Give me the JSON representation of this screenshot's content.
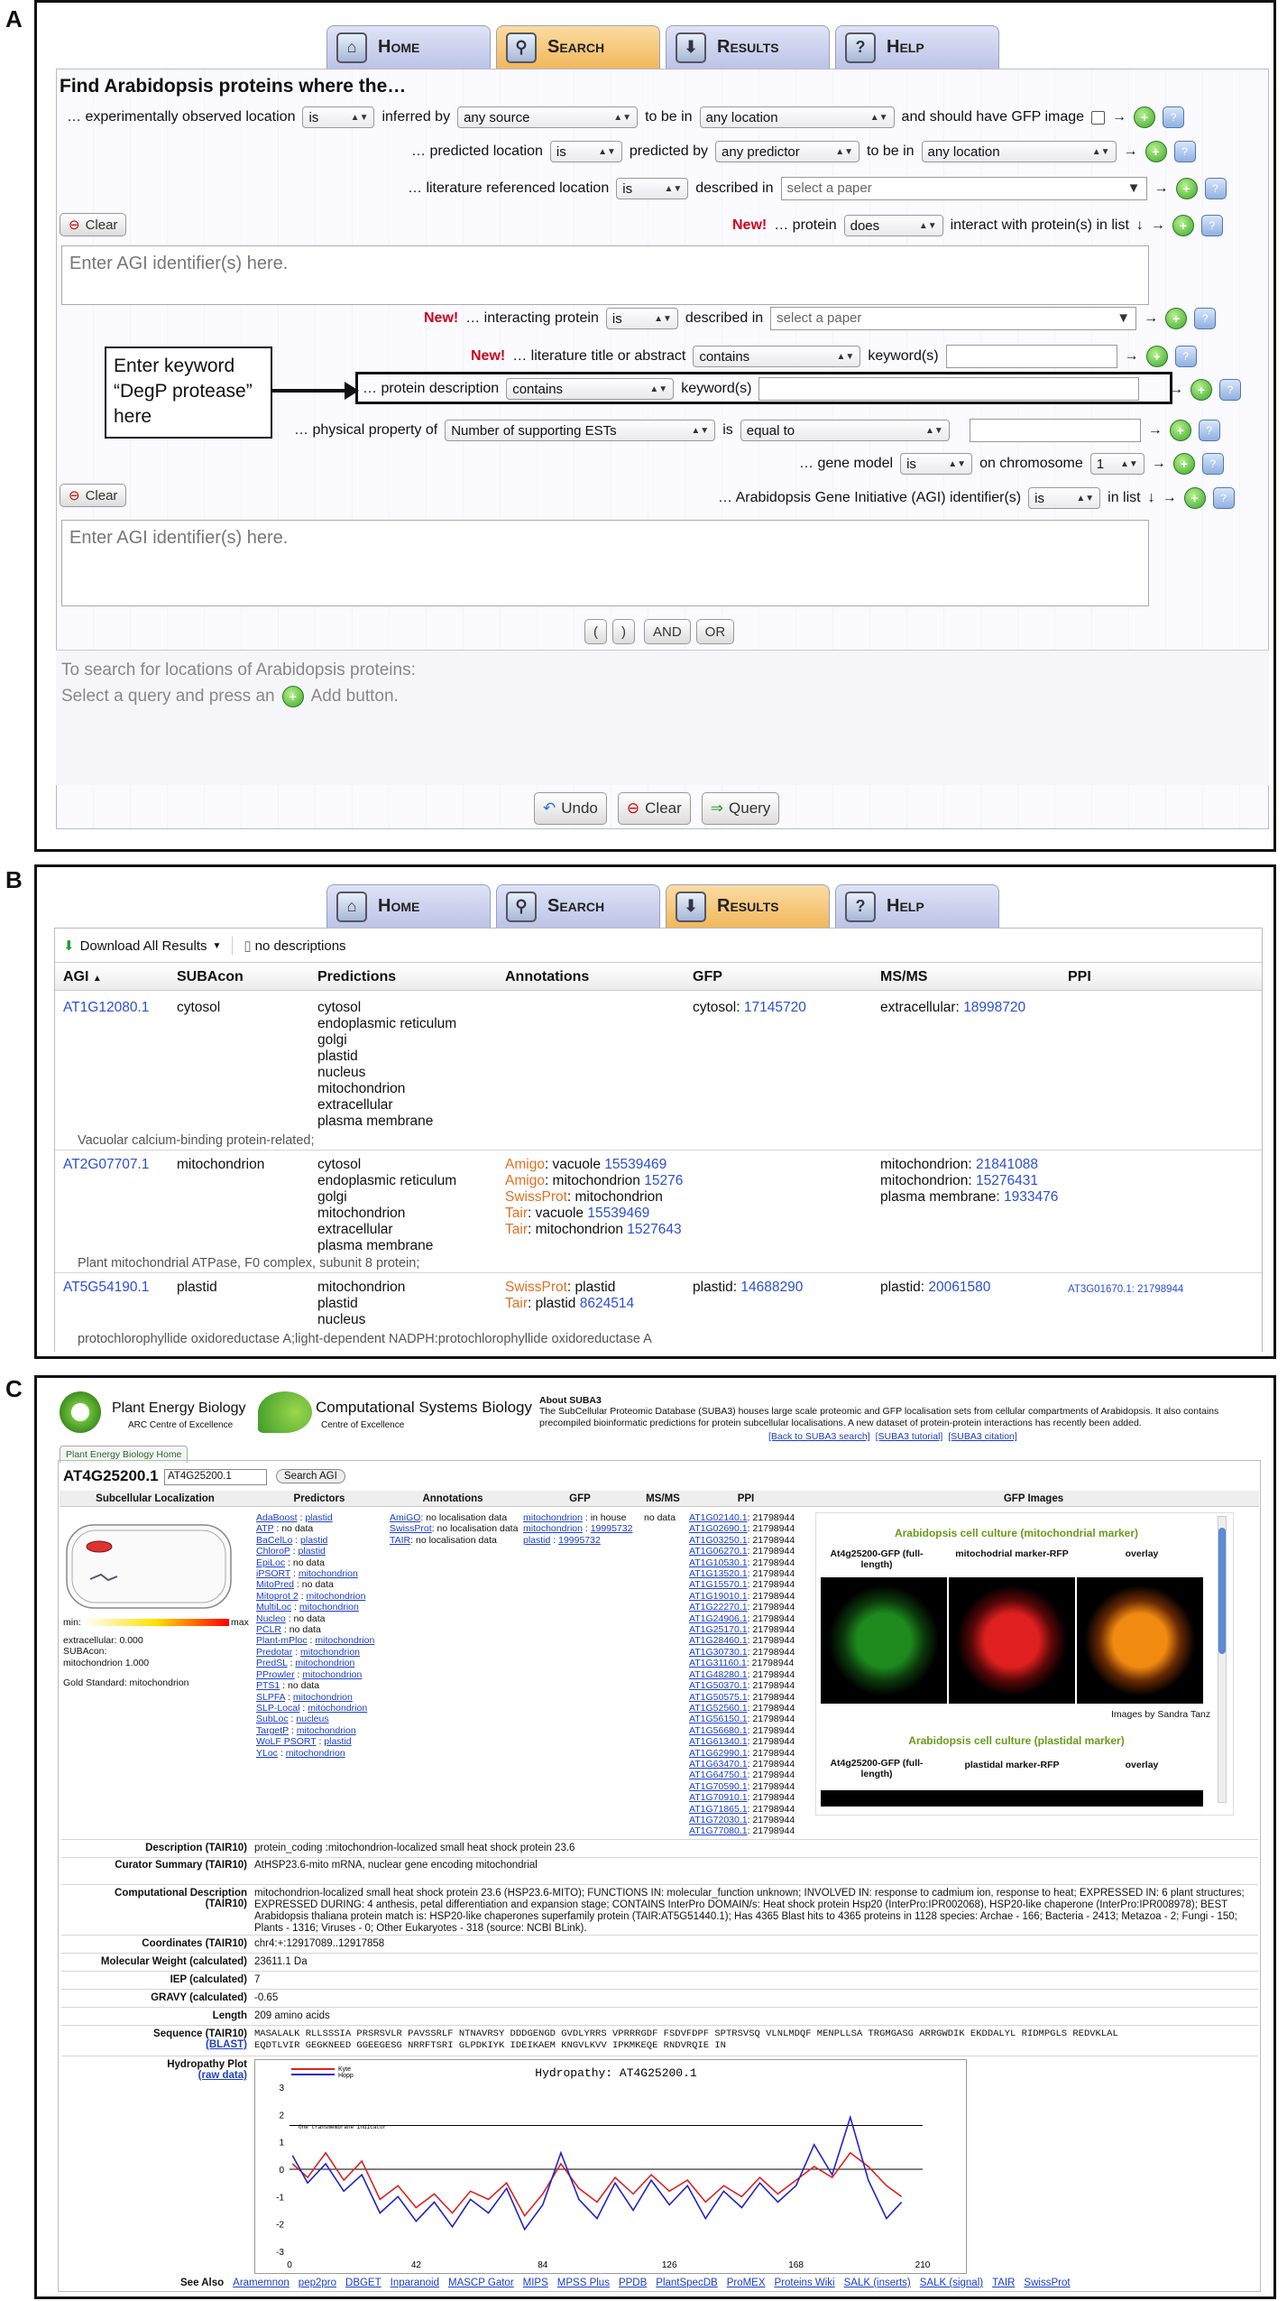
{
  "labels": {
    "a": "A",
    "b": "B",
    "c": "C"
  },
  "tabs": [
    {
      "label": "Home",
      "icon": "home-icon"
    },
    {
      "label": "Search",
      "icon": "search-icon"
    },
    {
      "label": "Results",
      "icon": "download-icon"
    },
    {
      "label": "Help",
      "icon": "help-icon"
    }
  ],
  "query": {
    "title": "Find Arabidopsis proteins where the…",
    "r1": {
      "a": "… experimentally observed location",
      "op": "is",
      "b": "inferred by",
      "src": "any source",
      "c": "to be in",
      "loc": "any location",
      "d": "and should have GFP image"
    },
    "r2": {
      "a": "… predicted location",
      "op": "is",
      "b": "predicted by",
      "src": "any predictor",
      "c": "to be in",
      "loc": "any location"
    },
    "r3": {
      "a": "… literature referenced location",
      "op": "is",
      "b": "described in",
      "ph": "select a paper"
    },
    "clear": "Clear",
    "new": "New!",
    "r4": {
      "a": "… protein",
      "op": "does",
      "b": "interact with protein(s) in list",
      "arrow": "↓"
    },
    "agi_ph": "Enter AGI identifier(s) here.",
    "r5": {
      "a": "… interacting protein",
      "op": "is",
      "b": "described in",
      "ph": "select a paper"
    },
    "r6": {
      "a": "… literature title or abstract",
      "op": "contains",
      "b": "keyword(s)"
    },
    "r7": {
      "a": "… protein description",
      "op": "contains",
      "b": "keyword(s)"
    },
    "r8": {
      "a": "… physical property of",
      "prop": "Number of supporting ESTs",
      "b": "is",
      "op": "equal to"
    },
    "r9": {
      "a": "… gene model",
      "op": "is",
      "b": "on chromosome",
      "chr": "1"
    },
    "r10": {
      "a": "… Arabidopsis Gene Initiative (AGI) identifier(s)",
      "op": "is",
      "b": "in list",
      "arrow": "↓"
    },
    "callout": [
      "Enter keyword",
      "“DegP protease”",
      "here"
    ],
    "ops": [
      "(",
      ")",
      "AND",
      "OR"
    ],
    "hint1": "To search for locations of Arabidopsis proteins:",
    "hint2a": "Select a query and press an",
    "hint2b": "Add button.",
    "undo": "Undo",
    "clear2": "Clear",
    "query": "Query",
    "arrow": "→"
  },
  "results": {
    "download": "Download All Results",
    "no_desc": "no descriptions",
    "headers": [
      "AGI",
      "SUBAcon",
      "Predictions",
      "Annotations",
      "GFP",
      "MS/MS",
      "PPI"
    ],
    "r1": {
      "agi": "AT1G12080.1",
      "suba": "cytosol",
      "preds": [
        "cytosol",
        "endoplasmic reticulum",
        "golgi",
        "plastid",
        "nucleus",
        "mitochondrion",
        "extracellular",
        "plasma membrane"
      ],
      "gfp_l": "cytosol: ",
      "gfp_v": "17145720",
      "ms_l": "extracellular: ",
      "ms_v": "18998720",
      "desc": "Vacuolar calcium-binding protein-related;"
    },
    "r2": {
      "agi": "AT2G07707.1",
      "suba": "mitochondrion",
      "preds": [
        "cytosol",
        "endoplasmic reticulum",
        "golgi",
        "mitochondrion",
        "extracellular",
        "plasma membrane"
      ],
      "ann": [
        {
          "s": "Amigo",
          "t": ": vacuole ",
          "v": "15539469"
        },
        {
          "s": "Amigo",
          "t": ": mitochondrion ",
          "v": "15276"
        },
        {
          "s": "SwissProt",
          "t": ": mitochondrion",
          "v": ""
        },
        {
          "s": "Tair",
          "t": ": vacuole ",
          "v": "15539469"
        },
        {
          "s": "Tair",
          "t": ": mitochondrion ",
          "v": "1527643"
        }
      ],
      "ms": [
        {
          "t": "mitochondrion: ",
          "v": "21841088"
        },
        {
          "t": "mitochondrion: ",
          "v": "15276431"
        },
        {
          "t": "plasma membrane: ",
          "v": "1933476"
        }
      ],
      "desc": "Plant mitochondrial ATPase, F0 complex, subunit 8 protein;"
    },
    "r3": {
      "agi": "AT5G54190.1",
      "suba": "plastid",
      "preds": [
        "mitochondrion",
        "plastid",
        "nucleus"
      ],
      "ann": [
        {
          "s": "SwissProt",
          "t": ": plastid",
          "v": ""
        },
        {
          "s": "Tair",
          "t": ": plastid ",
          "v": "8624514"
        }
      ],
      "gfp_l": "plastid: ",
      "gfp_v": "14688290",
      "ms_l": "plastid: ",
      "ms_v": "20061580",
      "ppi": "AT3G01670.1: 21798944",
      "desc": "protochlorophyllide oxidoreductase A;light-dependent NADPH:protochlorophyllide oxidoreductase A"
    }
  },
  "suba": {
    "logo1": "Plant Energy Biology",
    "logo1b": "ARC Centre of Excellence",
    "logo2": "Computational Systems Biology",
    "logo2b": "Centre of Excellence",
    "about_t": "About SUBA3",
    "about": "The SubCellular Proteomic Database (SUBA3) houses large scale proteomic and GFP localisation sets from cellular compartments of Arabidopsis. It also contains precompiled bioinformatic predictions for protein subcellular localisations. A new dataset of protein-protein interactions has recently been added.",
    "links": [
      "[Back to SUBA3 search]",
      "[SUBA3 tutorial]",
      "[SUBA3 citation]"
    ],
    "home_tab": "Plant Energy Biology Home",
    "agi": "AT4G25200.1",
    "agi_input": "AT4G25200.1",
    "search": "Search AGI",
    "cols": [
      "Subcellular Localization",
      "Predictors",
      "Annotations",
      "GFP",
      "MS/MS",
      "PPI",
      "GFP Images"
    ],
    "min": "min:",
    "max": "max",
    "loc_info": [
      "extracellular: 0.000",
      "SUBAcon:",
      "mitochondrion 1.000",
      "",
      "Gold Standard: mitochondrion"
    ],
    "predictors": [
      [
        "AdaBoost",
        "plastid"
      ],
      [
        "ATP",
        "no data"
      ],
      [
        "BaCelLo",
        "plastid"
      ],
      [
        "ChloroP",
        "plastid"
      ],
      [
        "EpiLoc",
        "no data"
      ],
      [
        "iPSORT",
        "mitochondrion"
      ],
      [
        "MitoPred",
        "no data"
      ],
      [
        "Mitoprot 2",
        "mitochondrion"
      ],
      [
        "MultiLoc",
        "mitochondrion"
      ],
      [
        "Nucleo",
        "no data"
      ],
      [
        "PCLR",
        "no data"
      ],
      [
        "Plant-mPloc",
        "mitochondrion"
      ],
      [
        "Predotar",
        "mitochondrion"
      ],
      [
        "PredSL",
        "mitochondrion"
      ],
      [
        "PProwler",
        "mitochondrion"
      ],
      [
        "PTS1",
        "no data"
      ],
      [
        "SLPFA",
        "mitochondrion"
      ],
      [
        "SLP-Local",
        "mitochondrion"
      ],
      [
        "SubLoc",
        "nucleus"
      ],
      [
        "TargetP",
        "mitochondrion"
      ],
      [
        "WoLF PSORT",
        "plastid"
      ],
      [
        "YLoc",
        "mitochondrion"
      ]
    ],
    "ann": [
      [
        "AmiGO",
        "no localisation data"
      ],
      [
        "SwissProt",
        "no localisation data"
      ],
      [
        "TAIR",
        "no localisation data"
      ]
    ],
    "gfp": [
      [
        "mitochondrion",
        "in house"
      ],
      [
        "mitochondrion",
        "19995732"
      ],
      [
        "plastid",
        "19995732"
      ]
    ],
    "msms": "no data",
    "ppi": [
      "AT1G02140.1",
      "AT1G02690.1",
      "AT1G03250.1",
      "AT1G06270.1",
      "AT1G10530.1",
      "AT1G13520.1",
      "AT1G15570.1",
      "AT1G19010.1",
      "AT1G22270.1",
      "AT1G24906.1",
      "AT1G25170.1",
      "AT1G28460.1",
      "AT1G30730.1",
      "AT1G31160.1",
      "AT1G48280.1",
      "AT1G50370.1",
      "AT1G50575.1",
      "AT1G52560.1",
      "AT1G56150.1",
      "AT1G56680.1",
      "AT1G61340.1",
      "AT1G62990.1",
      "AT1G63470.1",
      "AT1G64750.1",
      "AT1G70590.1",
      "AT1G70910.1",
      "AT1G71865.1",
      "AT1G72030.1",
      "AT1G77080.1"
    ],
    "ppi_v": ": 21798944",
    "img1_t": "Arabidopsis cell culture (mitochondrial marker)",
    "img_cols": [
      "At4g25200-GFP (full-length)",
      "mitochodrial marker-RFP",
      "overlay"
    ],
    "credit": "Images by Sandra Tanz",
    "img2_t": "Arabidopsis cell culture (plastidal marker)",
    "img2_cols": [
      "At4g25200-GFP (full-length)",
      "plastidal marker-RFP",
      "overlay"
    ],
    "info": [
      {
        "l": "Description (TAIR10)",
        "v": "protein_coding :mitochondrion-localized small heat shock protein 23.6"
      },
      {
        "l": "Curator Summary (TAIR10)",
        "v": "AtHSP23.6-mito mRNA, nuclear gene encoding mitochondrial"
      },
      {
        "l": "Computational Description (TAIR10)",
        "v": "mitochondrion-localized small heat shock protein 23.6 (HSP23.6-MITO); FUNCTIONS IN: molecular_function unknown; INVOLVED IN: response to cadmium ion, response to heat; EXPRESSED IN: 6 plant structures; EXPRESSED DURING: 4 anthesis, petal differentiation and expansion stage; CONTAINS InterPro DOMAIN/s: Heat shock protein Hsp20 (InterPro:IPR002068), HSP20-like chaperone (InterPro:IPR008978); BEST Arabidopsis thaliana protein match is: HSP20-like chaperones superfamily protein (TAIR:AT5G51440.1); Has 4365 Blast hits to 4365 proteins in 1128 species: Archae - 166; Bacteria - 2413; Metazoa - 2; Fungi - 150; Plants - 1316; Viruses - 0; Other Eukaryotes - 318 (source: NCBI BLink)."
      },
      {
        "l": "Coordinates (TAIR10)",
        "v": "chr4:+:12917089..12917858"
      },
      {
        "l": "Molecular Weight (calculated)",
        "v": "23611.1 Da"
      },
      {
        "l": "IEP (calculated)",
        "v": "7"
      },
      {
        "l": "GRAVY (calculated)",
        "v": "-0.65"
      },
      {
        "l": "Length",
        "v": "209 amino acids"
      }
    ],
    "seq_l": "Sequence (TAIR10)",
    "seq_blast": "(BLAST)",
    "seq1": "MASALALK RLLSSSIA PRSRSVLR PAVSSRLF NTNAVRSY DDDGENGD GVDLYRRS VPRRRGDF FSDVFDPF SPTRSVSQ VLNLMDQF MENPLLSA TRGMGASG ARRGWDIK EKDDALYL RIDMPGLS REDVKLAL",
    "seq2": "EQDTLVIR GEGKNEED GGEEGESG NRRFTSRI GLPDKIYK IDEIKAEM KNGVLKVV IPKMKEQE RNDVRQIE IN",
    "hyd_l": "Hydropathy Plot",
    "hyd_raw": "(raw data)",
    "hyd_title": "Hydropathy: AT4G25200.1",
    "tm_ind": "One transmembrane indicator",
    "legend": [
      "Kyte",
      "Hopp"
    ],
    "chart_data": {
      "type": "line",
      "title": "Hydropathy: AT4G25200.1",
      "xlabel": "",
      "ylabel": "",
      "xlim": [
        0,
        210
      ],
      "ylim": [
        -3,
        3
      ],
      "xticks": [
        0,
        42,
        84,
        126,
        168,
        210
      ],
      "yticks": [
        -3,
        -2,
        -1,
        0,
        1,
        2,
        3
      ],
      "threshold": 1.6,
      "series": [
        {
          "name": "Kyte",
          "values": [
            [
              1,
              0.2
            ],
            [
              6,
              -0.3
            ],
            [
              12,
              0.6
            ],
            [
              18,
              -0.4
            ],
            [
              24,
              0.3
            ],
            [
              30,
              -1.1
            ],
            [
              36,
              -0.6
            ],
            [
              42,
              -1.4
            ],
            [
              48,
              -0.9
            ],
            [
              54,
              -1.6
            ],
            [
              60,
              -0.8
            ],
            [
              66,
              -1.1
            ],
            [
              72,
              -0.5
            ],
            [
              78,
              -1.7
            ],
            [
              84,
              -0.9
            ],
            [
              90,
              0.2
            ],
            [
              96,
              -0.7
            ],
            [
              102,
              -1.2
            ],
            [
              108,
              -0.3
            ],
            [
              114,
              -0.9
            ],
            [
              120,
              -0.2
            ],
            [
              126,
              -0.8
            ],
            [
              132,
              -0.4
            ],
            [
              138,
              -1.2
            ],
            [
              144,
              -0.6
            ],
            [
              150,
              -1.0
            ],
            [
              156,
              -0.3
            ],
            [
              162,
              -0.9
            ],
            [
              168,
              -0.4
            ],
            [
              174,
              0.1
            ],
            [
              180,
              -0.3
            ],
            [
              186,
              0.6
            ],
            [
              192,
              0.1
            ],
            [
              198,
              -0.6
            ],
            [
              203,
              -1.0
            ]
          ]
        },
        {
          "name": "Hopp",
          "values": [
            [
              1,
              0.5
            ],
            [
              6,
              -0.5
            ],
            [
              12,
              0.2
            ],
            [
              18,
              -0.8
            ],
            [
              24,
              -0.2
            ],
            [
              30,
              -1.6
            ],
            [
              36,
              -1.0
            ],
            [
              42,
              -1.9
            ],
            [
              48,
              -1.2
            ],
            [
              54,
              -2.1
            ],
            [
              60,
              -1.1
            ],
            [
              66,
              -1.6
            ],
            [
              72,
              -0.7
            ],
            [
              78,
              -2.2
            ],
            [
              84,
              -1.3
            ],
            [
              90,
              0.6
            ],
            [
              96,
              -1.1
            ],
            [
              102,
              -1.8
            ],
            [
              108,
              -0.5
            ],
            [
              114,
              -1.5
            ],
            [
              120,
              -0.4
            ],
            [
              126,
              -1.3
            ],
            [
              132,
              -0.6
            ],
            [
              138,
              -1.8
            ],
            [
              144,
              -0.8
            ],
            [
              150,
              -1.4
            ],
            [
              156,
              -0.5
            ],
            [
              162,
              -1.2
            ],
            [
              168,
              -0.6
            ],
            [
              174,
              0.9
            ],
            [
              180,
              -0.2
            ],
            [
              186,
              1.9
            ],
            [
              192,
              -0.4
            ],
            [
              198,
              -1.8
            ],
            [
              203,
              -1.2
            ]
          ]
        }
      ]
    },
    "see_l": "See Also",
    "see": [
      "Aramemnon",
      "pep2pro",
      "DBGET",
      "Inparanoid",
      "MASCP Gator",
      "MIPS",
      "MPSS Plus",
      "PPDB",
      "PlantSpecDB",
      "ProMEX",
      "Proteins Wiki",
      "SALK (inserts)",
      "SALK (signal)",
      "TAIR",
      "SwissProt"
    ]
  }
}
